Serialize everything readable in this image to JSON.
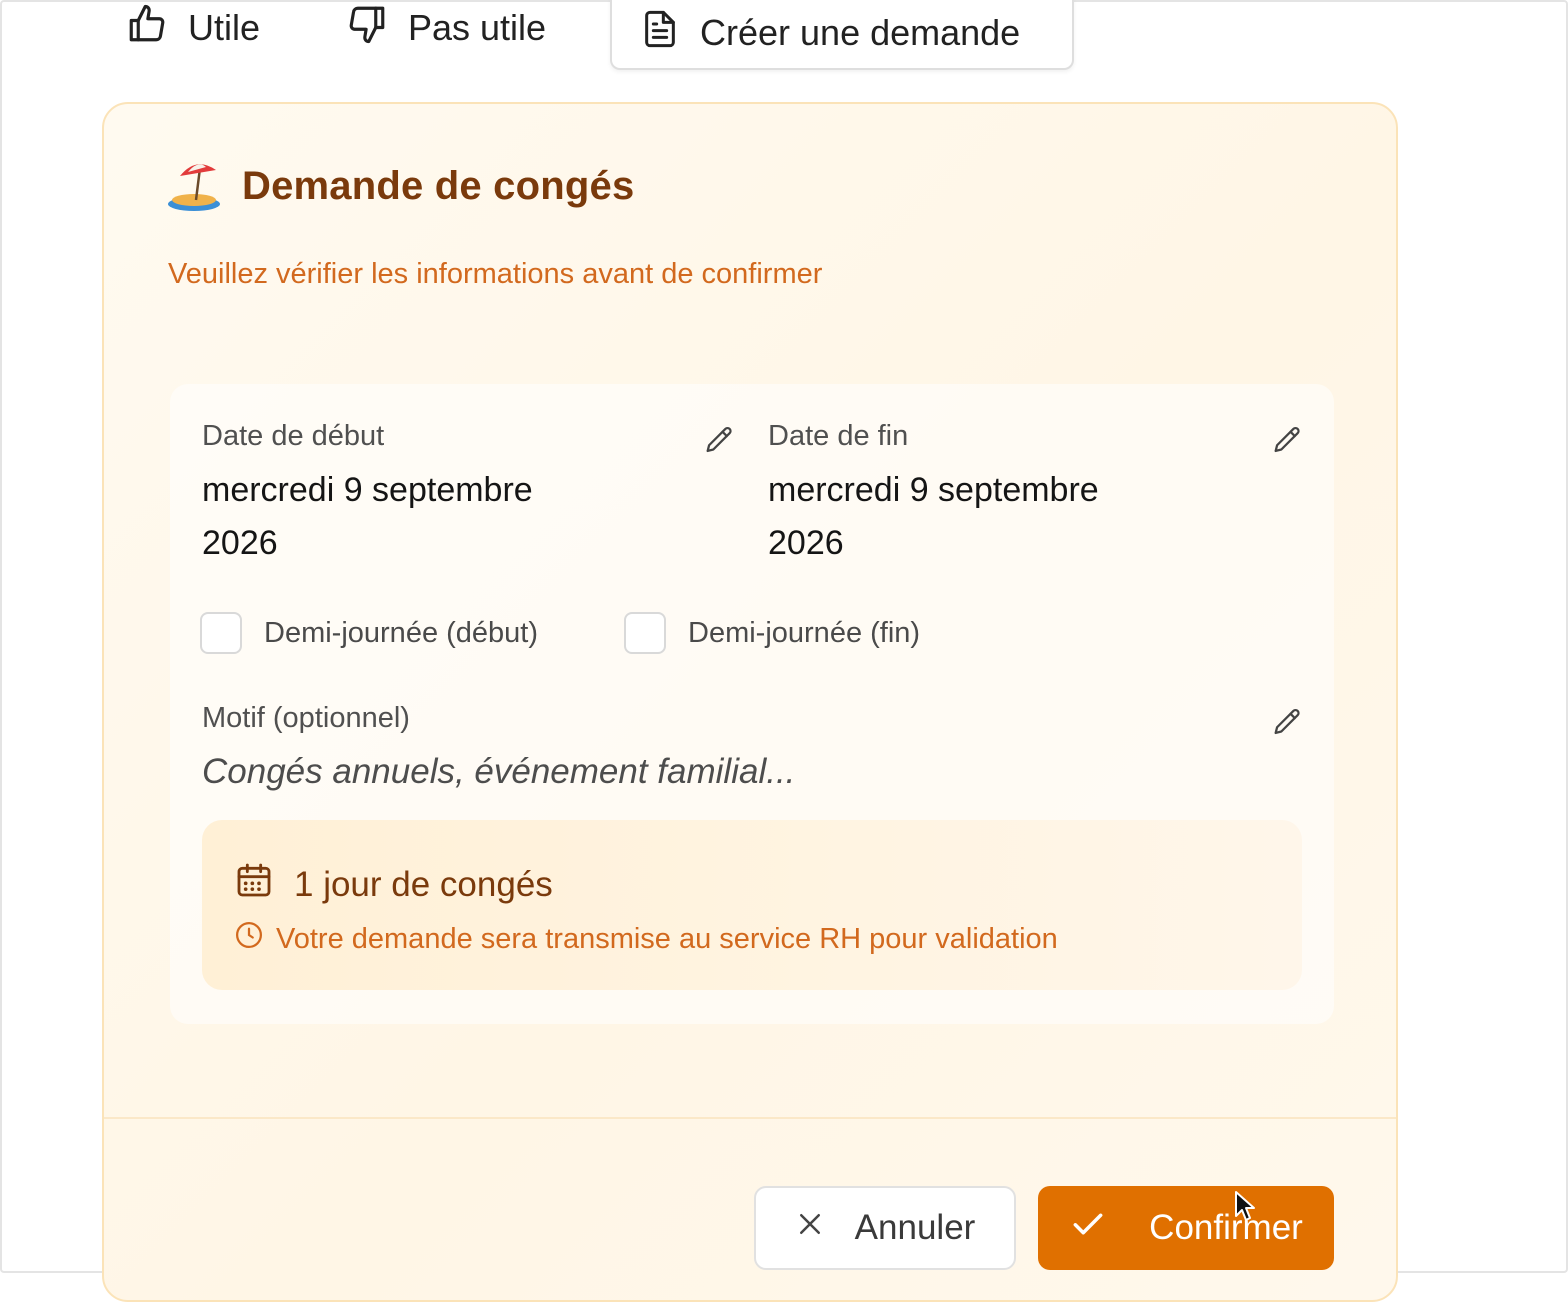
{
  "feedback": {
    "utile_label": "Utile",
    "pas_utile_label": "Pas utile",
    "create_request_label": "Créer une demande"
  },
  "card": {
    "title": "Demande de congés",
    "subtitle": "Veuillez vérifier les informations avant de confirmer",
    "start_date": {
      "label": "Date de début",
      "value_line1": "mercredi 9 septembre",
      "value_line2": "2026"
    },
    "end_date": {
      "label": "Date de fin",
      "value_line1": "mercredi 9 septembre",
      "value_line2": "2026"
    },
    "half_day_start": {
      "label": "Demi-journée (début)",
      "checked": false
    },
    "half_day_end": {
      "label": "Demi-journée (fin)",
      "checked": false
    },
    "motif": {
      "label": "Motif (optionnel)",
      "placeholder": "Congés annuels, événement familial..."
    },
    "summary": {
      "days_text": "1 jour de congés",
      "note": "Votre demande sera transmise au service RH pour validation"
    }
  },
  "actions": {
    "cancel_label": "Annuler",
    "confirm_label": "Confirmer"
  },
  "colors": {
    "accent": "#e07000",
    "title": "#7a3a0c",
    "subtitle": "#d2691e",
    "card_bg": "#fff6e6"
  }
}
